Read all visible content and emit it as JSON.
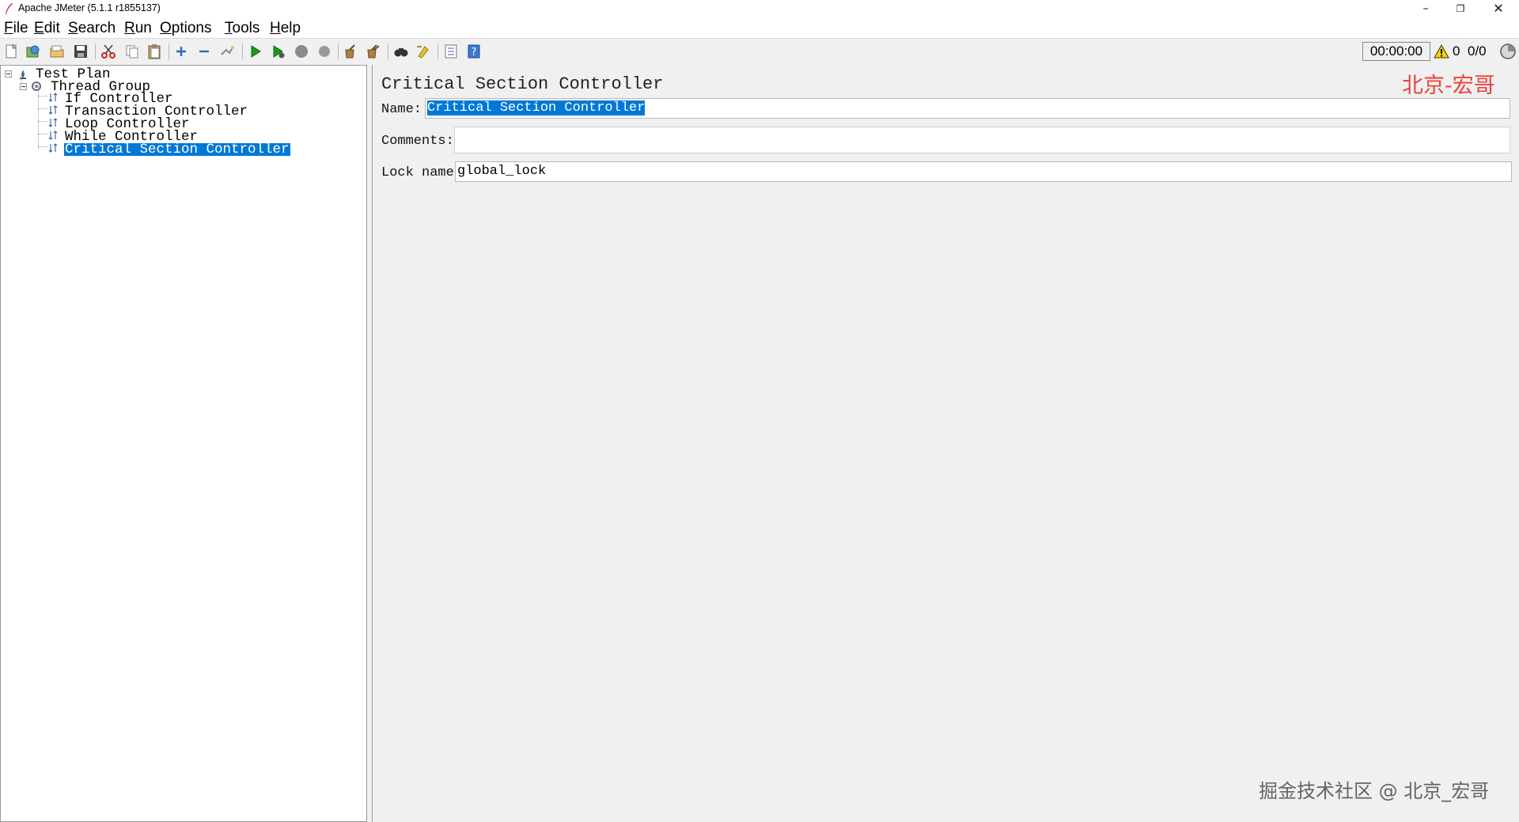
{
  "window": {
    "title": "Apache JMeter (5.1.1 r1855137)",
    "minimize": "–",
    "maximize": "❐",
    "close": "✕"
  },
  "menu": [
    {
      "label": "File"
    },
    {
      "label": "Edit"
    },
    {
      "label": "Search"
    },
    {
      "label": "Run"
    },
    {
      "label": "Options"
    },
    {
      "label": "Tools"
    },
    {
      "label": "Help"
    }
  ],
  "toolbar": {
    "icons": [
      "new-icon",
      "templates-icon",
      "open-icon",
      "save-icon",
      "cut-icon",
      "copy-icon",
      "paste-icon",
      "expand-icon",
      "collapse-icon",
      "toggle-icon",
      "start-icon",
      "start-no-pauses-icon",
      "stop-icon",
      "shutdown-icon",
      "clear-icon",
      "clear-all-icon",
      "search-icon",
      "reset-search-icon",
      "function-helper-icon",
      "help-icon"
    ],
    "timer": "00:00:00",
    "warnings": "0",
    "threads": "0/0"
  },
  "tree": [
    {
      "label": "Test Plan",
      "icon": "test-plan-icon",
      "level": 0,
      "expanded": true,
      "selected": false
    },
    {
      "label": "Thread Group",
      "icon": "thread-group-icon",
      "level": 1,
      "expanded": true,
      "selected": false
    },
    {
      "label": "If Controller",
      "icon": "controller-icon",
      "level": 2,
      "selected": false
    },
    {
      "label": "Transaction Controller",
      "icon": "controller-icon",
      "level": 2,
      "selected": false
    },
    {
      "label": "Loop Controller",
      "icon": "controller-icon",
      "level": 2,
      "selected": false
    },
    {
      "label": "While Controller",
      "icon": "controller-icon",
      "level": 2,
      "selected": false
    },
    {
      "label": "Critical Section Controller",
      "icon": "controller-icon",
      "level": 2,
      "selected": true
    }
  ],
  "panel": {
    "title": "Critical Section Controller",
    "watermark": "北京-宏哥",
    "name_label": "Name:",
    "name_value": "Critical Section Controller",
    "comments_label": "Comments:",
    "comments_value": "",
    "lock_label": "Lock name",
    "lock_value": "global_lock"
  },
  "footer_watermark": "掘金技术社区 @ 北京_宏哥",
  "colors": {
    "selection": "#0078d7",
    "watermark_red": "#e8423c",
    "start_green": "#1a9a1a"
  }
}
